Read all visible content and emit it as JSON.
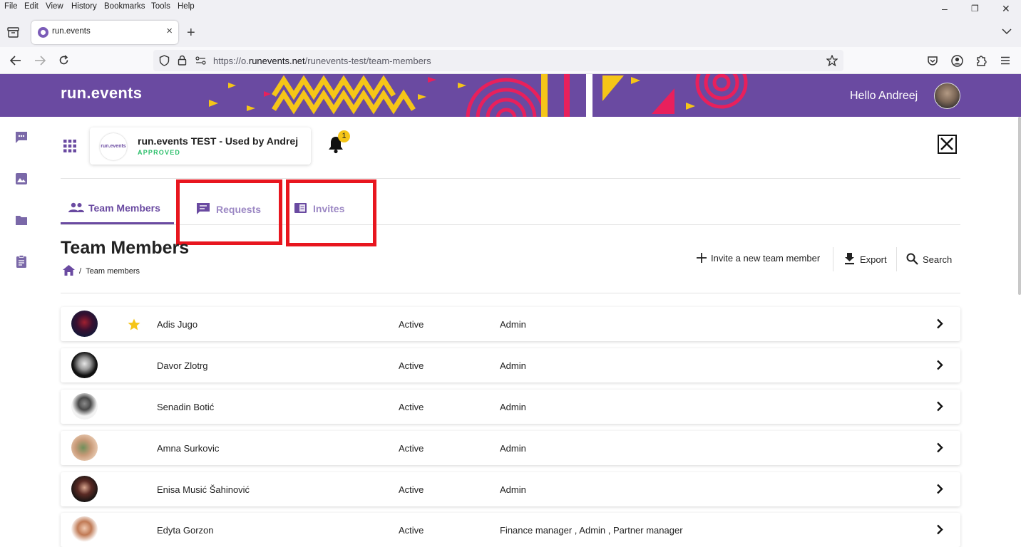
{
  "browser": {
    "menu": [
      "File",
      "Edit",
      "View",
      "History",
      "Bookmarks",
      "Tools",
      "Help"
    ],
    "tab_title": "run.events",
    "tab_close": "×",
    "new_tab": "+",
    "url_prefix": "https://o.",
    "url_domain": "runevents.net",
    "url_path": "/runevents-test/team-members",
    "window_controls": [
      "–",
      "❐",
      "✕"
    ]
  },
  "banner": {
    "logo": "run.events",
    "greeting": "Hello Andreej",
    "colors": {
      "purple": "#6a4aa1",
      "yellow": "#f5c518",
      "pink": "#e8205c"
    }
  },
  "org": {
    "logo_text": "run.events",
    "name": "run.events TEST - Used by Andrej",
    "status": "APPROVED",
    "notification_count": "1"
  },
  "tabs": [
    {
      "label": "Team Members",
      "icon": "people-icon",
      "active": true
    },
    {
      "label": "Requests",
      "icon": "chat-icon",
      "active": false
    },
    {
      "label": "Invites",
      "icon": "book-icon",
      "active": false
    }
  ],
  "page": {
    "title": "Team Members",
    "breadcrumb": "Team members",
    "breadcrumb_sep": "/",
    "actions": {
      "invite": "Invite a new team member",
      "export": "Export",
      "search": "Search"
    }
  },
  "members": [
    {
      "name": "Adis Jugo",
      "status": "Active",
      "role": "Admin",
      "starred": true
    },
    {
      "name": "Davor Zlotrg",
      "status": "Active",
      "role": "Admin",
      "starred": false
    },
    {
      "name": "Senadin Botić",
      "status": "Active",
      "role": "Admin",
      "starred": false
    },
    {
      "name": "Amna Surkovic",
      "status": "Active",
      "role": "Admin",
      "starred": false
    },
    {
      "name": "Enisa Musić Šahinović",
      "status": "Active",
      "role": "Admin",
      "starred": false
    },
    {
      "name": "Edyta Gorzon",
      "status": "Active",
      "role": "Finance manager , Admin , Partner manager",
      "starred": false
    }
  ]
}
